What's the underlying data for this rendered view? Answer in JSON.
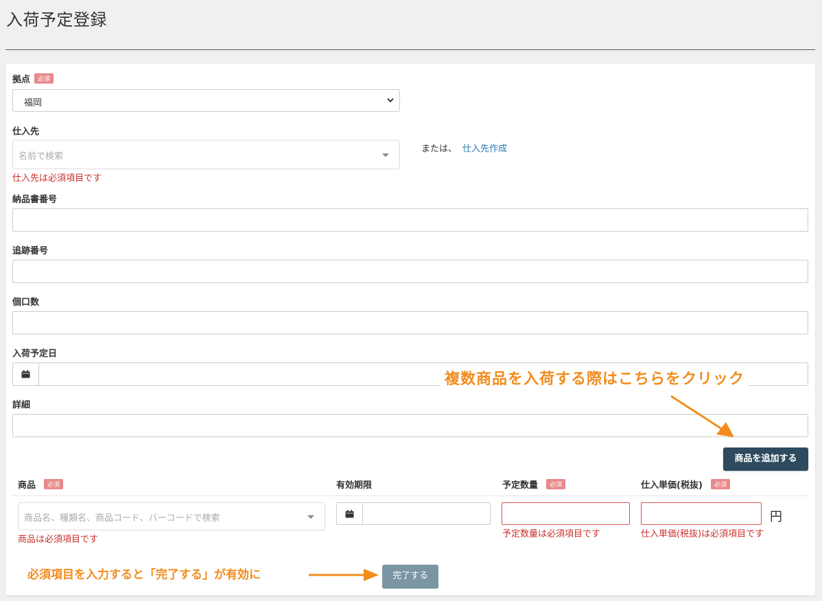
{
  "page": {
    "title": "入荷予定登録"
  },
  "form": {
    "location": {
      "label": "拠点",
      "required": "必須",
      "value": "福岡"
    },
    "supplier": {
      "label": "仕入先",
      "placeholder": "名前で検索",
      "or_text": "または、",
      "create_link": "仕入先作成",
      "error": "仕入先は必須項目です"
    },
    "delivery_note": {
      "label": "納品書番号"
    },
    "tracking": {
      "label": "追跡番号"
    },
    "package_count": {
      "label": "個口数"
    },
    "arrival_date": {
      "label": "入荷予定日"
    },
    "details": {
      "label": "詳細"
    },
    "add_product_button": "商品を追加する",
    "items": {
      "headers": {
        "product": "商品",
        "expiry": "有効期限",
        "planned_qty": "予定数量",
        "unit_price": "仕入単価(税抜)",
        "required": "必須"
      },
      "product_placeholder": "商品名、種類名、商品コード、バーコードで検索",
      "product_error": "商品は必須項目です",
      "qty_error": "予定数量は必須項目です",
      "price_error": "仕入単価(税抜)は必須項目です",
      "currency": "円"
    },
    "complete_button": "完了する"
  },
  "annotations": {
    "add_hint": "複数商品を入荷する際はこちらをクリック",
    "complete_hint": "必須項目を入力すると「完了する」が有効に"
  },
  "colors": {
    "accent_orange": "#f28c1d",
    "error_red": "#c9302c",
    "required_badge": "#e9888a",
    "primary_button": "#2d4a5e",
    "disabled_button": "#7a95a3",
    "link": "#2a7ab0"
  },
  "icons": [
    "chevron-down-icon",
    "caret-down-icon",
    "calendar-icon",
    "arrow-icon"
  ]
}
